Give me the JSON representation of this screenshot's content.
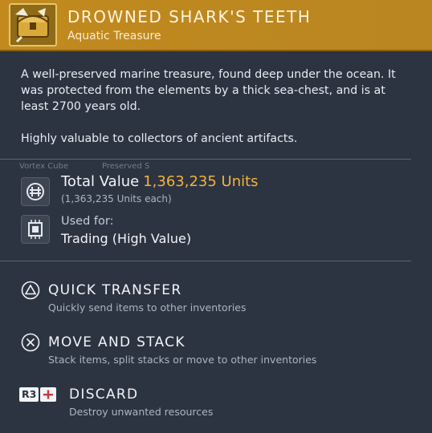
{
  "item": {
    "name": "DROWNED SHARK'S TEETH",
    "category": "Aquatic Treasure",
    "icon": "treasure-chest-icon",
    "header_color": "#c28a1e"
  },
  "description": {
    "paragraph_1": "A well-preserved marine treasure, found deep under the ocean. It was protected from the elements by a thick sea-chest, and is at least 2700 years old.",
    "paragraph_2": "Highly valuable to collectors of ancient artifacts."
  },
  "background_inventory": {
    "labels": [
      "Vortex Cube",
      "Preserved S"
    ]
  },
  "value": {
    "icon": "units-currency-icon",
    "label": "Total Value",
    "amount": "1,363,235 Units",
    "each": "(1,363,235 Units each)",
    "accent_color": "#f2b33d"
  },
  "usage": {
    "icon": "trade-chip-icon",
    "label": "Used for:",
    "value": "Trading (High Value)"
  },
  "actions": [
    {
      "button": "triangle-button-icon",
      "title": "QUICK TRANSFER",
      "subtitle": "Quickly send items to other inventories"
    },
    {
      "button": "cross-button-icon",
      "title": "MOVE AND STACK",
      "subtitle": "Stack items, split stacks or move to other inventories"
    },
    {
      "button": "r3-button-icon",
      "button_label": "R3",
      "title": "DISCARD",
      "subtitle": "Destroy unwanted resources"
    }
  ]
}
